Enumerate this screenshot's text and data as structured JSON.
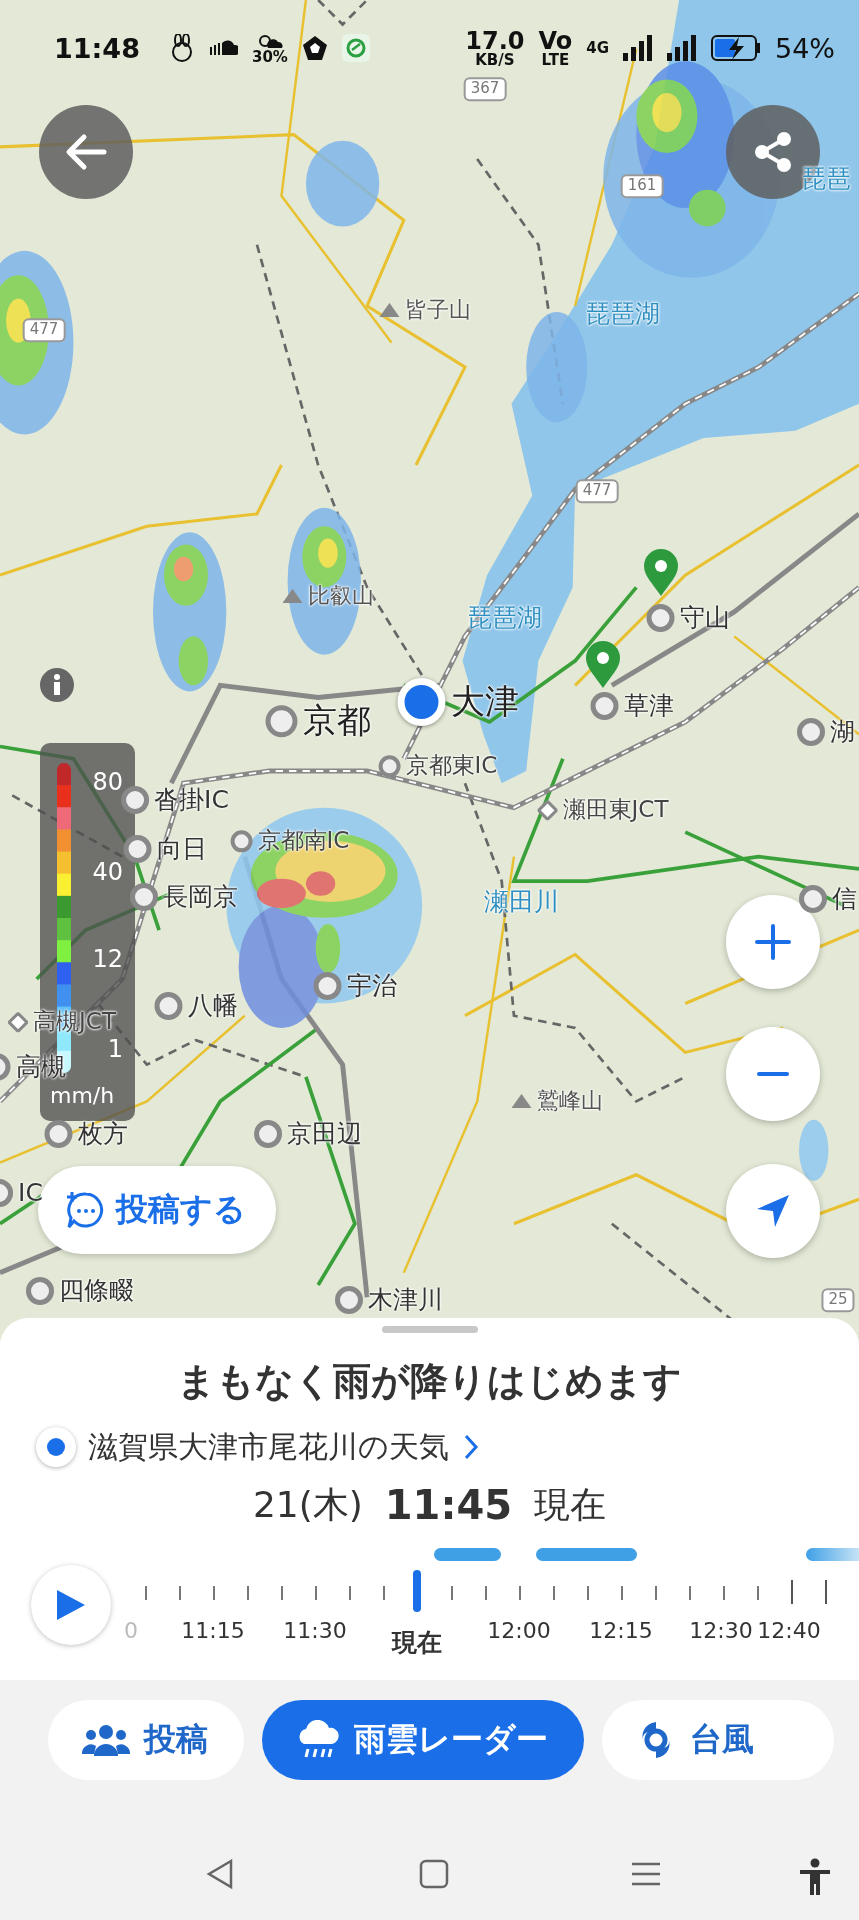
{
  "status_bar": {
    "time": "11:48",
    "weather_percent": "30%",
    "speed_value": "17.0",
    "speed_unit": "KB/S",
    "volte": "Vo",
    "lte": "LTE",
    "network": "4G",
    "battery": "54%"
  },
  "map": {
    "labels": [
      {
        "text": "367",
        "kind": "road"
      },
      {
        "text": "161",
        "kind": "road"
      },
      {
        "text": "琵琶",
        "kind": "water"
      },
      {
        "text": "皆子山",
        "kind": "mountain"
      },
      {
        "text": "琵琶湖",
        "kind": "water"
      },
      {
        "text": "477",
        "kind": "road"
      },
      {
        "text": "477",
        "kind": "road"
      },
      {
        "text": "比叡山",
        "kind": "mountain"
      },
      {
        "text": "琵琶湖",
        "kind": "water"
      },
      {
        "text": "守山",
        "kind": "city"
      },
      {
        "text": "京都",
        "kind": "capital"
      },
      {
        "text": "大津",
        "kind": "current"
      },
      {
        "text": "草津",
        "kind": "city"
      },
      {
        "text": "湖",
        "kind": "city"
      },
      {
        "text": "京都東IC",
        "kind": "ic"
      },
      {
        "text": "沓掛IC",
        "kind": "city"
      },
      {
        "text": "瀬田東JCT",
        "kind": "jct"
      },
      {
        "text": "京都南IC",
        "kind": "ic"
      },
      {
        "text": "向日",
        "kind": "city"
      },
      {
        "text": "長岡京",
        "kind": "city"
      },
      {
        "text": "瀬田川",
        "kind": "water"
      },
      {
        "text": "信",
        "kind": "city"
      },
      {
        "text": "宇治",
        "kind": "city"
      },
      {
        "text": "八幡",
        "kind": "city"
      },
      {
        "text": "高槻JCT",
        "kind": "jct"
      },
      {
        "text": "高槻",
        "kind": "city"
      },
      {
        "text": "鷲峰山",
        "kind": "mountain"
      },
      {
        "text": "枚方",
        "kind": "city"
      },
      {
        "text": "京田辺",
        "kind": "city"
      },
      {
        "text": "IC",
        "kind": "city"
      },
      {
        "text": "四條畷",
        "kind": "city"
      },
      {
        "text": "木津川",
        "kind": "city"
      },
      {
        "text": "25",
        "kind": "road"
      }
    ],
    "legend": {
      "ticks": [
        "80",
        "40",
        "12",
        "1"
      ],
      "unit": "mm/h"
    },
    "post_button": "投稿する"
  },
  "sheet": {
    "headline": "まもなく雨が降りはじめます",
    "location": "滋賀県大津市尾花川の天気",
    "date": "21(木)",
    "time": "11:45",
    "time_note": "現在",
    "timeline": [
      {
        "label": "0",
        "selected": false
      },
      {
        "label": "11:15",
        "selected": false
      },
      {
        "label": "11:30",
        "selected": false
      },
      {
        "label": "現在",
        "selected": true
      },
      {
        "label": "12:00",
        "selected": false
      },
      {
        "label": "12:15",
        "selected": false
      },
      {
        "label": "12:30",
        "selected": false
      },
      {
        "label": "12:40",
        "selected": false
      }
    ]
  },
  "tabs": [
    {
      "label": "投稿",
      "selected": false
    },
    {
      "label": "雨雲レーダー",
      "selected": true
    },
    {
      "label": "台風",
      "selected": false
    }
  ]
}
